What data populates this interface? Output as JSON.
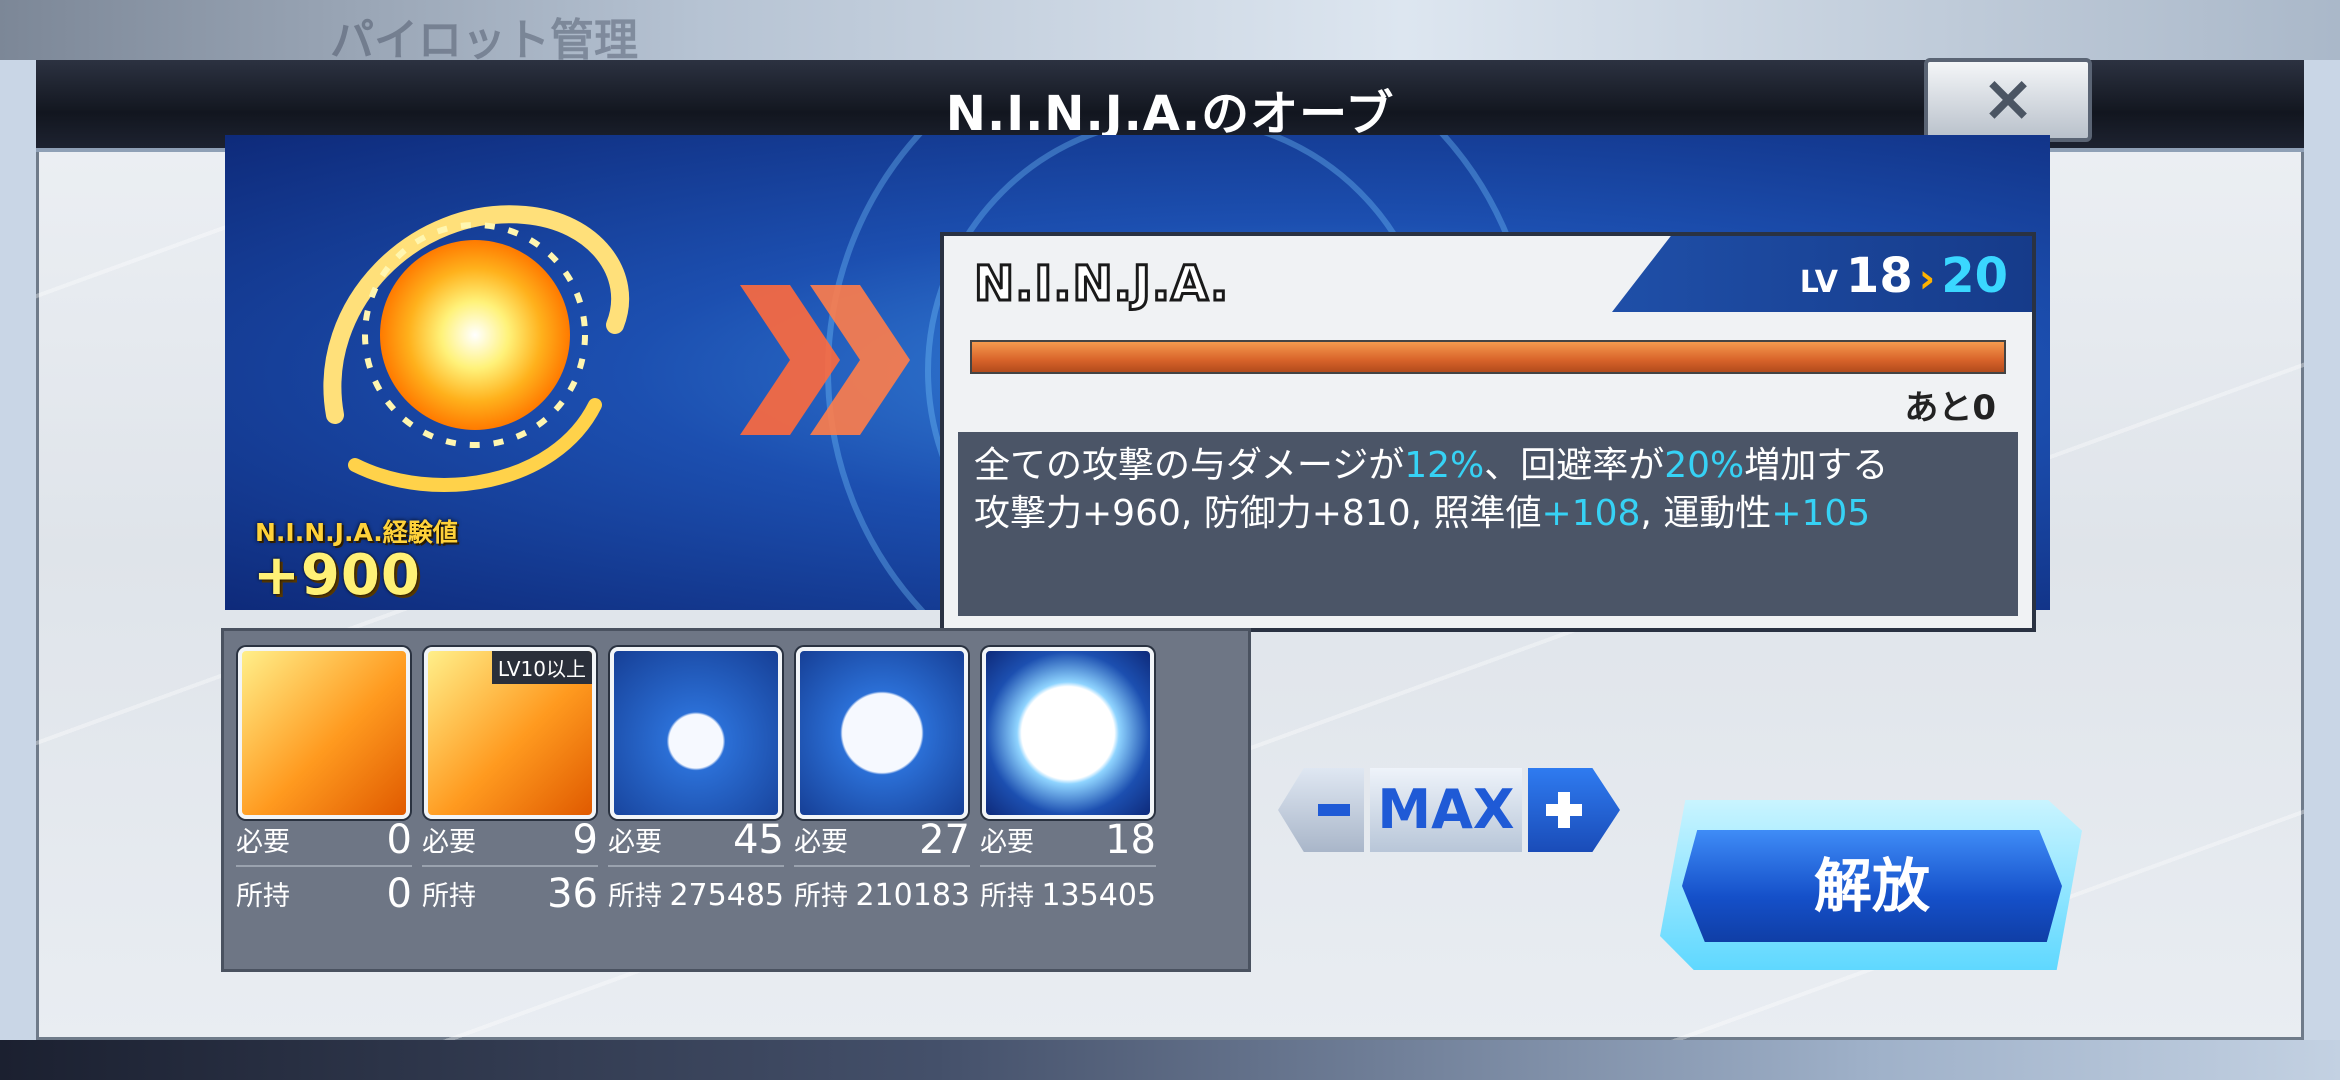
{
  "background": {
    "ghost_title": "パイロット管理"
  },
  "header": {
    "title": "N.I.N.J.A.のオーブ",
    "close_icon": "×"
  },
  "banner": {
    "exp_label": "N.I.N.J.A.経験値",
    "exp_value": "+900"
  },
  "card": {
    "unit_name": "N.I.N.J.A.",
    "lv_label": "LV",
    "lv_current": "18",
    "lv_arrow": "›",
    "lv_next": "20",
    "exp_fill": 1.0,
    "remaining": "あと0",
    "desc": {
      "a": "全ての攻撃の与ダメージが",
      "b": "12%",
      "c": "、回避率が",
      "d": "20%",
      "e": "増加する",
      "f": "攻撃力+960, 防御力+810, 照準値",
      "g": "+108",
      "h": ", 運動性",
      "i": "+105"
    }
  },
  "materials": [
    {
      "badge": "",
      "need_label": "必要",
      "need": "0",
      "own_label": "所持",
      "own": "0"
    },
    {
      "badge": "LV10以上",
      "need_label": "必要",
      "need": "9",
      "own_label": "所持",
      "own": "36"
    },
    {
      "badge": "",
      "need_label": "必要",
      "need": "45",
      "own_label": "所持",
      "own": "275485"
    },
    {
      "badge": "",
      "need_label": "必要",
      "need": "27",
      "own_label": "所持",
      "own": "210183"
    },
    {
      "badge": "",
      "need_label": "必要",
      "need": "18",
      "own_label": "所持",
      "own": "135405"
    }
  ],
  "stepper": {
    "max_label": "MAX"
  },
  "release_button": {
    "label": "解放"
  },
  "colors": {
    "accent_cyan": "#36d2f5",
    "bar_orange": "#d8632a",
    "button_blue": "#1550c9"
  }
}
